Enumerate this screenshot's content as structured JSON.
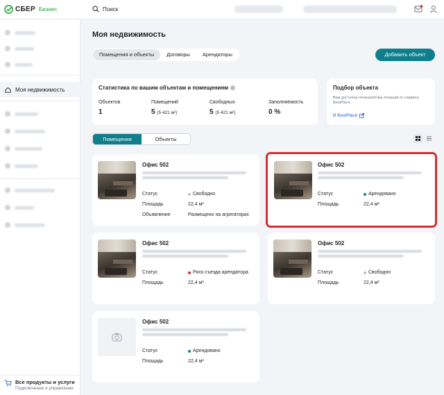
{
  "topbar": {
    "logo_text": "СБЕР",
    "logo_sub": "Бизнес",
    "search_placeholder": "Поиск"
  },
  "sidebar": {
    "active_label": "Моя недвижимость",
    "bottom_title": "Все продукты и услуги",
    "bottom_sub": "Подключение и управление"
  },
  "page": {
    "title": "Моя недвижимость",
    "tabs": [
      "Помещения и объекты",
      "Договоры",
      "Арендаторы"
    ],
    "add_button": "Добавить объект"
  },
  "stats": {
    "title": "Статистика по вашим объектам и помещениям",
    "items": [
      {
        "label": "Объектов",
        "value": "1",
        "extra": ""
      },
      {
        "label": "Помещений",
        "value": "5",
        "extra": "(5 421 м²)"
      },
      {
        "label": "Свободных",
        "value": "5",
        "extra": "(5 421 м²)"
      },
      {
        "label": "Заполняемость",
        "value": "0 %",
        "extra": ""
      }
    ]
  },
  "picker": {
    "title": "Подбор объекта",
    "desc": "Вам доступна геоаналитика локаций от сервиса BestPlace.",
    "link": "В BestPlace"
  },
  "segment": [
    "Помещения",
    "Объекты"
  ],
  "labels": {
    "status": "Статус",
    "area": "Площадь",
    "listing": "Объявление"
  },
  "colors": {
    "accent": "#107f8c",
    "free": "#b8c0c7",
    "rented": "#107f8c",
    "risk": "#d0302e",
    "highlight": "#d0302e"
  },
  "cards": [
    {
      "name": "Офис 502",
      "status": "Свободно",
      "status_color": "#b8c0c7",
      "area": "22,4 м²",
      "listing": "Размещено на агрегаторах",
      "photo": true
    },
    {
      "name": "Офис 502",
      "status": "Арендовано",
      "status_color": "#107f8c",
      "area": "22,4 м²",
      "listing": "",
      "photo": true
    },
    {
      "name": "Офис 502",
      "status": "Риск съезда арендатора",
      "status_color": "#d0302e",
      "area": "22,4 м²",
      "listing": "",
      "photo": true
    },
    {
      "name": "Офис 502",
      "status": "Свободно",
      "status_color": "#b8c0c7",
      "area": "22,4 м²",
      "listing": "",
      "photo": true
    },
    {
      "name": "Офис 502",
      "status": "Арендовано",
      "status_color": "#107f8c",
      "area": "22,4 м²",
      "listing": "",
      "photo": false
    }
  ]
}
